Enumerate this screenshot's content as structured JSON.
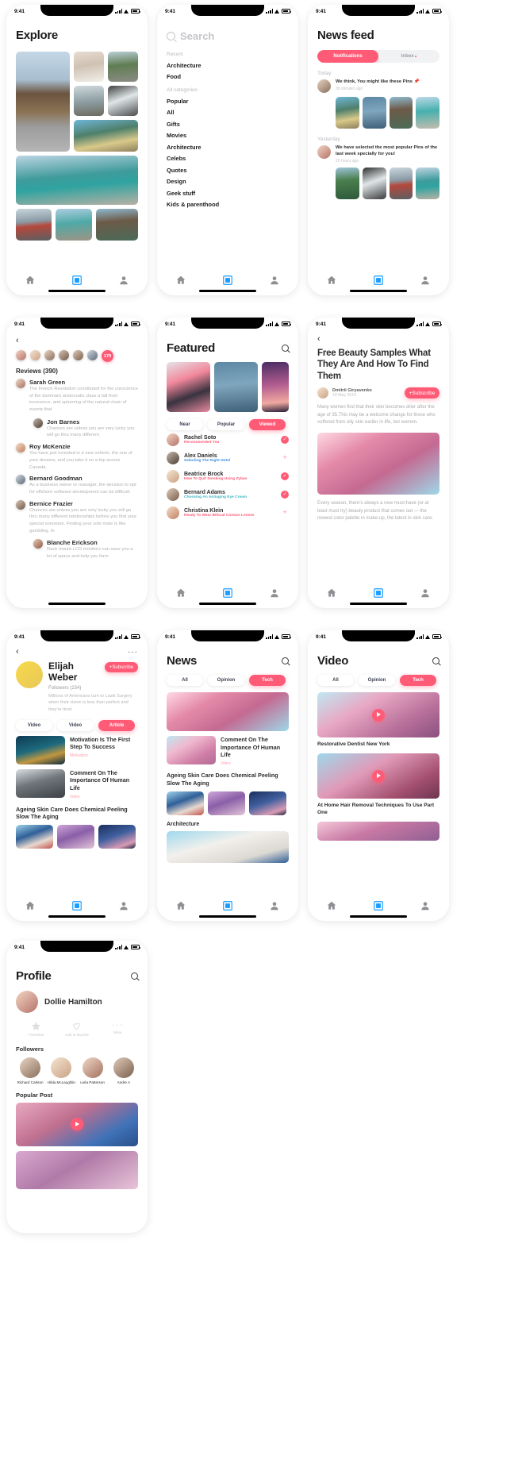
{
  "status_bar": {
    "time": "9:41"
  },
  "screens": {
    "explore": {
      "title": "Explore",
      "images": [
        "bridge",
        "mtn1",
        "road",
        "bench",
        "fall",
        "hiker",
        "lake",
        "redjacket",
        "lakegirl",
        "pier"
      ]
    },
    "search": {
      "placeholder": "Search",
      "recent_label": "Recent",
      "recent": [
        "Architecture",
        "Food"
      ],
      "all_label": "All categories",
      "categories": [
        "Popular",
        "All",
        "Gifts",
        "Movies",
        "Architecture",
        "Celebs",
        "Quotes",
        "Design",
        "Geek stuff",
        "Kids & parenthood"
      ]
    },
    "news_feed": {
      "title": "News feed",
      "tabs": [
        {
          "label": "Notifications",
          "active": true
        },
        {
          "label": "Inbox",
          "active": false,
          "dot": true
        }
      ],
      "sections": [
        {
          "label": "Today",
          "message": "We think, You might like these Pins 📌",
          "time": "30 minutes ago",
          "thumbs": [
            "hiker",
            "water",
            "pier",
            "lake2"
          ]
        },
        {
          "label": "Yesterday",
          "message": "We have selected the most popular Pins of the last week specially for you!",
          "time": "20 hours ago",
          "thumbs": [
            "canyon",
            "waterfall",
            "redjacket",
            "lake"
          ]
        }
      ]
    },
    "reviews": {
      "count_label": "Reviews (390)",
      "more_count": "179",
      "items": [
        {
          "name": "Sarah Green",
          "text": "The French Revolution constituted for the conscience of the dominant aristocratic class a fall from innocence, and upturning of the natural chain of events that",
          "indent": false
        },
        {
          "name": "Jon Barnes",
          "text": "Chances are unless you are very lucky you will go thru many different",
          "indent": true
        },
        {
          "name": "Roy McKenzie",
          "text": "You have just invested in a new vehicle, the one of your dreams, and you take it on a trip across Canada.",
          "indent": false
        },
        {
          "name": "Bernard Goodman",
          "text": "As a business owner or manager, the decision to opt for offshore software development can be difficult.",
          "indent": false
        },
        {
          "name": "Bernice Frazier",
          "text": "Chances are unless you are very lucky you will go thru many different relationships before you find your special someone. Finding your sole mate is like gambling. In",
          "indent": false
        },
        {
          "name": "Blanche Erickson",
          "text": "Rack mount LCD monitors can save you a lot of space and help you form",
          "indent": true
        }
      ]
    },
    "featured": {
      "title": "Featured",
      "hero": [
        "smoke",
        "water",
        "sunset"
      ],
      "filters": [
        {
          "label": "Near",
          "active": false
        },
        {
          "label": "Popular",
          "active": false
        },
        {
          "label": "Viewed",
          "active": true
        }
      ],
      "people": [
        {
          "name": "Rachel Soto",
          "sub": "Recommended You",
          "sub_color": "#ff5b77",
          "action": "check"
        },
        {
          "name": "Alex Daniels",
          "sub": "Selecting The Right Hotel",
          "sub_color": "#3f8fe0",
          "action": "plus"
        },
        {
          "name": "Beatrice Brock",
          "sub": "How To Quit Smoking Using Zyban",
          "sub_color": "#ff5b77",
          "action": "check"
        },
        {
          "name": "Bernard Adams",
          "sub": "Choosing An Antiaging Eye Cream",
          "sub_color": "#3fb5c4",
          "action": "check"
        },
        {
          "name": "Christina Klein",
          "sub": "Ready To Wear Bifocal Contact Lenses",
          "sub_color": "#ff5b77",
          "action": "plus"
        }
      ]
    },
    "article": {
      "title": "Free Beauty Samples What They Are And How To Find Them",
      "author": "Dmitrii Giryavenko",
      "date": "19 May 2018",
      "subscribe": "+Subscribe",
      "body_1": "Many women find that their skin becomes drier after the age of 35.This may be a welcome change for those who suffered from oily skin earlier in life, but women.",
      "body_2": "Every season, there's always a new must-have (or at least must try) beauty product that comes out — the newest color palette in make-up, the latest in skin care."
    },
    "profile_elijah": {
      "name": "Elijah Weber",
      "followers": "Followers (234)",
      "bio": "Millions of Americans turn to Lasik Surgery when their vision is less than perfect and they're tired.",
      "subscribe": "+Subscribe",
      "filters": [
        {
          "label": "Video",
          "active": false
        },
        {
          "label": "Video",
          "active": false
        },
        {
          "label": "Article",
          "active": true
        }
      ],
      "posts": [
        {
          "title": "Motivation Is The First Step To Success",
          "tag": "Motivation",
          "img": "turtle"
        },
        {
          "title": "Comment On The Importance Of Human Life",
          "tag": "Video",
          "img": "city"
        }
      ],
      "bottom_headline": "Ageing Skin Care Does Chemical Peeling Slow The Aging",
      "bottom_thumbs": [
        "bluebuild",
        "purplebuild",
        "nightbuild"
      ]
    },
    "news": {
      "title": "News",
      "filters": [
        {
          "label": "All",
          "active": false
        },
        {
          "label": "Opinion",
          "active": false
        },
        {
          "label": "Tech",
          "active": true
        }
      ],
      "hero_img": "pinkarch",
      "items": [
        {
          "title": "Comment On The Importance Of Human Life",
          "tag": "Video",
          "img": "pinkarch2"
        }
      ],
      "headline": "Ageing Skin Care Does Chemical Peeling Slow The Aging",
      "thumbs": [
        "bluebuild",
        "purplebuild",
        "nightbuild"
      ],
      "section_label": "Architecture",
      "section_img": "whitearch"
    },
    "video": {
      "title": "Video",
      "filters": [
        {
          "label": "All",
          "active": false
        },
        {
          "label": "Opinion",
          "active": false
        },
        {
          "label": "Tech",
          "active": true
        }
      ],
      "items": [
        {
          "caption": "Restorative Dentist New York",
          "img": "dent"
        },
        {
          "caption": "At Home Hair Removal Techniques To Use Part One",
          "img": "hairpink"
        }
      ]
    },
    "profile": {
      "title": "Profile",
      "name": "Dollie Hamilton",
      "actions": [
        {
          "label": "Favorites",
          "icon": "star-icon"
        },
        {
          "label": "Add to favorite",
          "icon": "heart-icon"
        },
        {
          "label": "More",
          "icon": "ellipsis-icon"
        }
      ],
      "followers_label": "Followers",
      "followers": [
        "Richard Carlson",
        "Hilda McLaughlin",
        "Leila Patterson",
        "Andre A"
      ],
      "popular_label": "Popular Post",
      "popular": [
        "pf1",
        "pf2"
      ]
    }
  },
  "tabbar": {
    "items": [
      "home-icon",
      "feed-icon",
      "profile-icon"
    ]
  },
  "colors": {
    "accent": "#ff5b77",
    "tab_active": "#1a9cff",
    "muted": "#b9bbc0"
  }
}
